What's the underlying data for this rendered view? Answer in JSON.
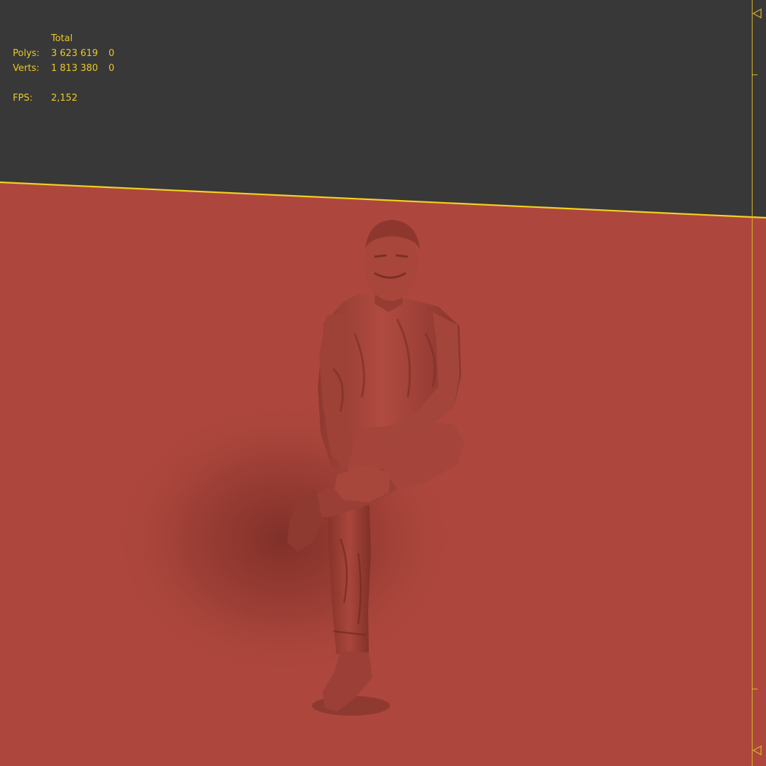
{
  "stats": {
    "header": "Total",
    "rows": [
      {
        "label": "Polys:",
        "total": "3 623 619",
        "selected": "0"
      },
      {
        "label": "Verts:",
        "total": "1 813 380",
        "selected": "0"
      }
    ],
    "fps_label": "FPS:",
    "fps_value": "2,152"
  },
  "colors": {
    "background": "#383838",
    "ground": "#ad473d",
    "model": "#a8453b",
    "horizon_line": "#f2d220",
    "overlay_text": "#e9c82b",
    "ruler": "#d9b52a"
  },
  "viewport": {
    "object": "seated-man-sculpt-icon",
    "ruler_markers": [
      "triangle-left-icon",
      "triangle-left-icon"
    ]
  }
}
